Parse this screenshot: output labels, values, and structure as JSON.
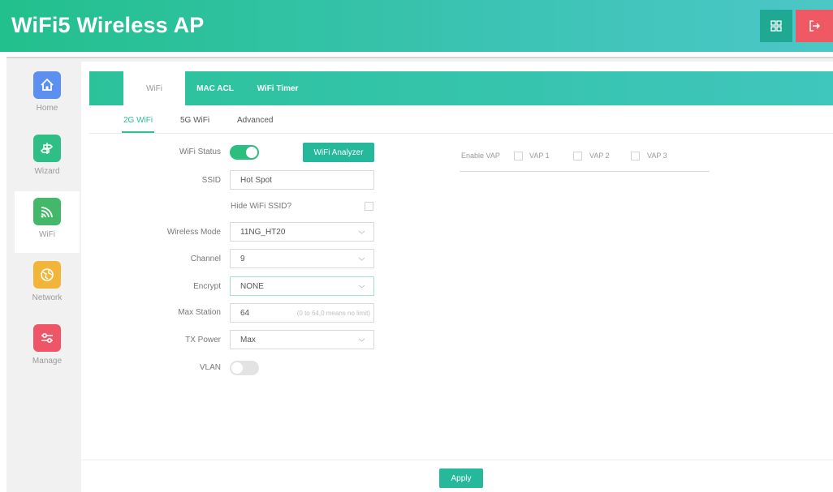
{
  "app": {
    "title": "WiFi5 Wireless AP"
  },
  "colors": {
    "accent": "#2bbf95",
    "header": "#22c08c",
    "logout": "#ef5964",
    "toggle_on": "#2bbf7e"
  },
  "sidebar": {
    "items": [
      {
        "label": "Home",
        "icon": "home-icon",
        "color": "#5b8ff0"
      },
      {
        "label": "Wizard",
        "icon": "wizard-icon",
        "color": "#2fbf86"
      },
      {
        "label": "WiFi",
        "icon": "wifi-icon",
        "color": "#44b86a",
        "active": true
      },
      {
        "label": "Network",
        "icon": "network-icon",
        "color": "#f3b43a"
      },
      {
        "label": "Manage",
        "icon": "manage-icon",
        "color": "#ee5668"
      }
    ]
  },
  "tabs": [
    {
      "label": "WiFi",
      "active": true
    },
    {
      "label": "MAC ACL"
    },
    {
      "label": "WiFi Timer"
    }
  ],
  "subtabs": [
    {
      "label": "2G WiFi",
      "active": true
    },
    {
      "label": "5G WiFi"
    },
    {
      "label": "Advanced"
    }
  ],
  "form": {
    "wifi_status_label": "WiFi Status",
    "wifi_status_on": true,
    "analyzer_button": "WiFi Analyzer",
    "ssid_label": "SSID",
    "ssid_value": "Hot Spot",
    "hide_ssid_label": "Hide WiFi SSID?",
    "hide_ssid_checked": false,
    "wireless_mode_label": "Wireless Mode",
    "wireless_mode_value": "11NG_HT20",
    "channel_label": "Channel",
    "channel_value": "9",
    "encrypt_label": "Encrypt",
    "encrypt_value": "NONE",
    "max_station_label": "Max Station",
    "max_station_value": "64",
    "max_station_hint": "(0 to 64,0 means no limit)",
    "tx_power_label": "TX Power",
    "tx_power_value": "Max",
    "vlan_label": "VLAN",
    "vlan_on": false
  },
  "vap": {
    "label": "Enable VAP",
    "options": [
      "VAP 1",
      "VAP 2",
      "VAP 3"
    ]
  },
  "footer": {
    "apply_label": "Apply"
  }
}
